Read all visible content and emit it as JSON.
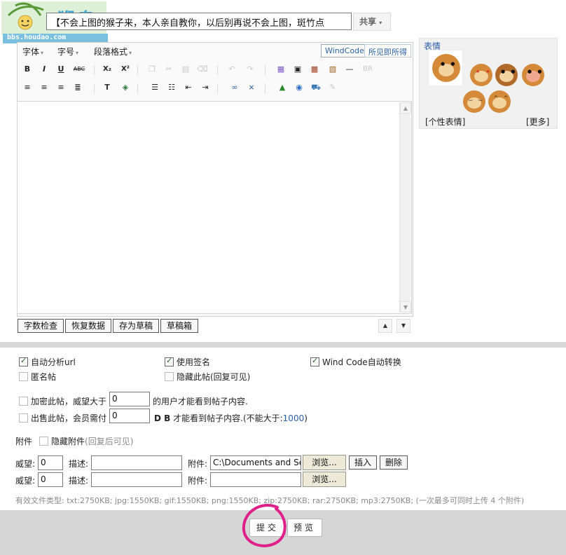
{
  "header": {
    "logo_text": "猴岛",
    "logo_url": "bbs.houdao.com",
    "title_value": "【不会上图的猴子来，本人亲自教你，以后别再说不会上图，斑竹点",
    "share_label": "共享"
  },
  "toolbar": {
    "font_label": "字体",
    "size_label": "字号",
    "para_label": "段落格式",
    "tab_windcode": "WindCode",
    "tab_wysiwyg": "所见即所得",
    "bold": "B",
    "italic": "I",
    "underline": "U",
    "strike": "ABC",
    "sub": "X₂",
    "sup": "X²",
    "br": "BR"
  },
  "editor_buttons": {
    "word_count": "字数检查",
    "restore": "恢复数据",
    "save_draft": "存为草稿",
    "draft_box": "草稿箱"
  },
  "emoticons": {
    "title": "表情",
    "custom": "[个性表情]",
    "more": "[更多]"
  },
  "options": {
    "auto_url": "自动分析url",
    "use_sig": "使用签名",
    "auto_windcode": "Wind Code自动转换",
    "anonymous": "匿名帖",
    "hide_post": "隐藏此帖(回复可见)",
    "encrypt_prefix": "加密此帖，威望大于",
    "encrypt_value": "0",
    "encrypt_suffix": "的用户才能看到帖子内容.",
    "sell_prefix": "出售此帖，会员需付",
    "sell_value": "0",
    "sell_suffix_db": "D B",
    "sell_suffix": "才能看到帖子内容.(不能大于:",
    "sell_max": "1000",
    "sell_close": ")"
  },
  "attachments": {
    "label": "附件",
    "hide_attach": "隐藏附件",
    "hide_attach_note": "(回复后可见)",
    "rows": [
      {
        "prestige_label": "威望:",
        "prestige_value": "0",
        "desc_label": "描述:",
        "desc_value": "",
        "file_label": "附件:",
        "file_value": "C:\\Documents and Sett",
        "browse": "浏览...",
        "insert": "插入",
        "delete": "删除"
      },
      {
        "prestige_label": "威望:",
        "prestige_value": "0",
        "desc_label": "描述:",
        "desc_value": "",
        "file_label": "附件:",
        "file_value": "",
        "browse": "浏览..."
      }
    ],
    "file_types": "有效文件类型: txt:2750KB; jpg:1550KB; gif:1550KB; png:1550KB; zip:2750KB; rar:2750KB; mp3:2750KB; (一次最多可同时上传 4 个附件)"
  },
  "footer": {
    "submit": "提交",
    "preview": "预览"
  },
  "colors": {
    "accent_blue": "#2a5ea6",
    "highlight_circle": "#e0208a"
  }
}
